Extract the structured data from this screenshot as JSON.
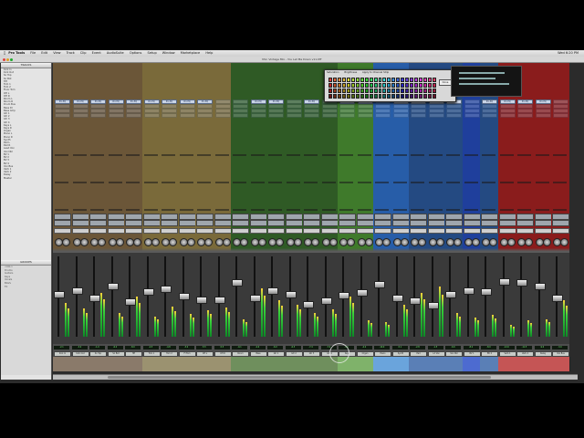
{
  "menu": {
    "app_name": "Pro Tools",
    "items": [
      "File",
      "Edit",
      "View",
      "Track",
      "Clip",
      "Event",
      "AudioSuite",
      "Options",
      "Setup",
      "Window",
      "Marketplace",
      "Help"
    ],
    "clock": "Wed 6:20 PM"
  },
  "window": {
    "title": "Mix: Vintage Mix - You Let Me Down v11-MT"
  },
  "sidebar": {
    "tracks_header": "TRACKS",
    "tracks": [
      "Kick In",
      "Kick Out",
      "Sn Top",
      "Sn Bot",
      "HH",
      "Tom 1",
      "Tom 2",
      "Floor Tom",
      "OH L",
      "OH R",
      "Room L",
      "Room R",
      "Drum Bus",
      "Bass DI",
      "Bass Amp",
      "Gtr 1",
      "Gtr 2",
      "Gtr 3",
      "Gtr 4",
      "Keys L",
      "Keys R",
      "Organ",
      "Piano L",
      "Piano R",
      "Synth",
      "Pad L",
      "Pad R",
      "Lead Vox",
      "Vox Dbl",
      "BV 1",
      "BV 2",
      "BV 3",
      "BV 4",
      "Vox Bus",
      "Verb 1",
      "Verb 2",
      "Delay",
      "Master"
    ],
    "groups_header": "GROUPS",
    "groups": [
      "<ALL>",
      "Drums",
      "Guitars",
      "Keys",
      "Vocals",
      "BGVs",
      "FX"
    ]
  },
  "palette": {
    "tabs": [
      "Saturation",
      "Brightness",
      "Apply to Channel Strip"
    ],
    "ok_label": "Done"
  },
  "strips": [
    {
      "name": "Kick In",
      "insert": "Pro EQ",
      "volume": "-2.1",
      "fader": 0.55,
      "meter": 0.42,
      "color": "#6b5638",
      "bottom": "#8a7a6a"
    },
    {
      "name": "Kick Out",
      "insert": "Pro EQ",
      "volume": "-3.4",
      "fader": 0.6,
      "meter": 0.35,
      "color": "#6b5638",
      "bottom": "#8a7a6a"
    },
    {
      "name": "Sn Top",
      "insert": "Pro EQ",
      "volume": "-1.0",
      "fader": 0.5,
      "meter": 0.55,
      "color": "#6b5638",
      "bottom": "#8a7a6a"
    },
    {
      "name": "Sn Bot",
      "insert": "Pro EQ",
      "volume": "-6.2",
      "fader": 0.65,
      "meter": 0.3,
      "color": "#6b5638",
      "bottom": "#8a7a6a"
    },
    {
      "name": "HH",
      "insert": "Pro EQ",
      "volume": "-8.0",
      "fader": 0.45,
      "meter": 0.5,
      "color": "#6b5638",
      "bottom": "#8a7a6a"
    },
    {
      "name": "Tom 1",
      "insert": "Pro EQ",
      "volume": "-4.5",
      "fader": 0.58,
      "meter": 0.25,
      "color": "#7a6a3a",
      "bottom": "#9b9270"
    },
    {
      "name": "Tom 2",
      "insert": "Pro EQ",
      "volume": "-4.8",
      "fader": 0.62,
      "meter": 0.38,
      "color": "#7a6a3a",
      "bottom": "#9b9270"
    },
    {
      "name": "Fl Tom",
      "insert": "Pro EQ",
      "volume": "-3.2",
      "fader": 0.52,
      "meter": 0.28,
      "color": "#7a6a3a",
      "bottom": "#9b9270"
    },
    {
      "name": "OH L",
      "insert": "Pro EQ",
      "volume": "-5.5",
      "fader": 0.48,
      "meter": 0.33,
      "color": "#7a6a3a",
      "bottom": "#9b9270"
    },
    {
      "name": "OH R",
      "insert": "",
      "volume": "-5.5",
      "fader": 0.48,
      "meter": 0.36,
      "color": "#7a6a3a",
      "bottom": "#9b9270"
    },
    {
      "name": "Room",
      "insert": "",
      "volume": "-9.1",
      "fader": 0.7,
      "meter": 0.22,
      "color": "#2f5a25",
      "bottom": "#6f8f5d"
    },
    {
      "name": "Bass",
      "insert": "Pro EQ",
      "volume": "-2.0",
      "fader": 0.5,
      "meter": 0.6,
      "color": "#2f5a25",
      "bottom": "#6f8f5d"
    },
    {
      "name": "Gtr 1",
      "insert": "Pro EQ",
      "volume": "-6.0",
      "fader": 0.6,
      "meter": 0.45,
      "color": "#2f5a25",
      "bottom": "#6f8f5d"
    },
    {
      "name": "Gtr 2",
      "insert": "",
      "volume": "-6.3",
      "fader": 0.55,
      "meter": 0.4,
      "color": "#2f5a25",
      "bottom": "#6f8f5d"
    },
    {
      "name": "Gtr 3",
      "insert": "Pro EQ",
      "volume": "-7.4",
      "fader": 0.42,
      "meter": 0.3,
      "color": "#2f5a25",
      "bottom": "#6f8f5d"
    },
    {
      "name": "Gtr 4",
      "insert": "",
      "volume": "-7.0",
      "fader": 0.47,
      "meter": 0.34,
      "color": "#2f5a25",
      "bottom": "#6f8f5d"
    },
    {
      "name": "Keys",
      "insert": "Pro EQ",
      "volume": "-3.9",
      "fader": 0.53,
      "meter": 0.5,
      "color": "#3f7a2b",
      "bottom": "#7fb26a"
    },
    {
      "name": "Organ",
      "insert": "Pro EQ",
      "volume": "-4.2",
      "fader": 0.57,
      "meter": 0.2,
      "color": "#3f7a2b",
      "bottom": "#7fb26a"
    },
    {
      "name": "Piano",
      "insert": "",
      "volume": "-10.0",
      "fader": 0.68,
      "meter": 0.18,
      "color": "#275da8",
      "bottom": "#6aa4dc"
    },
    {
      "name": "Synth",
      "insert": "Pro EQ",
      "volume": "-5.1",
      "fader": 0.5,
      "meter": 0.4,
      "color": "#275da8",
      "bottom": "#6aa4dc"
    },
    {
      "name": "Pad",
      "insert": "Pro EQ",
      "volume": "-2.8",
      "fader": 0.46,
      "meter": 0.55,
      "color": "#244a82",
      "bottom": "#5a7fb6"
    },
    {
      "name": "Ld Vox",
      "insert": "Pro EQ",
      "volume": "-1.5",
      "fader": 0.4,
      "meter": 0.62,
      "color": "#244a82",
      "bottom": "#5a7fb6"
    },
    {
      "name": "Vox Dbl",
      "insert": "Pro EQ",
      "volume": "-6.6",
      "fader": 0.55,
      "meter": 0.3,
      "color": "#244a82",
      "bottom": "#5a7fb6"
    },
    {
      "name": "BV 1",
      "insert": "",
      "volume": "-8.2",
      "fader": 0.6,
      "meter": 0.24,
      "color": "#1f3f9c",
      "bottom": "#4d6bd0"
    },
    {
      "name": "BV 2",
      "insert": "Pro EQ",
      "volume": "-8.0",
      "fader": 0.58,
      "meter": 0.27,
      "color": "#244a82",
      "bottom": "#5a7fb6"
    },
    {
      "name": "Verb 1",
      "insert": "Pro EQ",
      "volume": "-12.0",
      "fader": 0.72,
      "meter": 0.15,
      "color": "#8a1c1c",
      "bottom": "#c55555"
    },
    {
      "name": "Verb 2",
      "insert": "Pro EQ",
      "volume": "-11.5",
      "fader": 0.7,
      "meter": 0.2,
      "color": "#8a1c1c",
      "bottom": "#c55555"
    },
    {
      "name": "Delay",
      "insert": "Pro EQ",
      "volume": "-9.0",
      "fader": 0.65,
      "meter": 0.22,
      "color": "#8a1c1c",
      "bottom": "#c55555"
    },
    {
      "name": "Vox Bus",
      "insert": "",
      "volume": "-3.0",
      "fader": 0.5,
      "meter": 0.45,
      "color": "#8a1c1c",
      "bottom": "#c55555"
    }
  ]
}
